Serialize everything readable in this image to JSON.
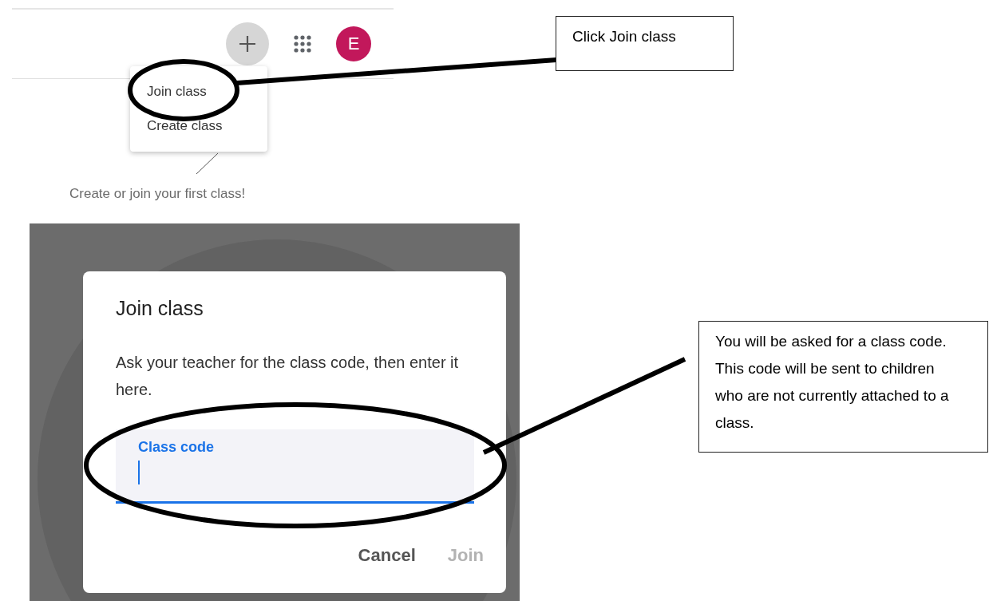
{
  "classroom_header": {
    "avatar": {
      "letter": "E",
      "color": "#c2185b"
    }
  },
  "add_menu": {
    "items": [
      {
        "label": "Join class"
      },
      {
        "label": "Create class"
      }
    ]
  },
  "empty_state": {
    "hint": "Create or join your first class!"
  },
  "join_dialog": {
    "title": "Join class",
    "description": "Ask your teacher for the class code, then enter it here.",
    "field": {
      "label": "Class code",
      "focused": true
    },
    "buttons": [
      {
        "label": "Cancel",
        "disabled": false
      },
      {
        "label": "Join",
        "disabled": true
      }
    ]
  },
  "callouts": [
    {
      "text": "Click Join class"
    },
    {
      "text": "You will be asked for a class code. This code will be sent to children who are not currently attached to a class."
    }
  ]
}
